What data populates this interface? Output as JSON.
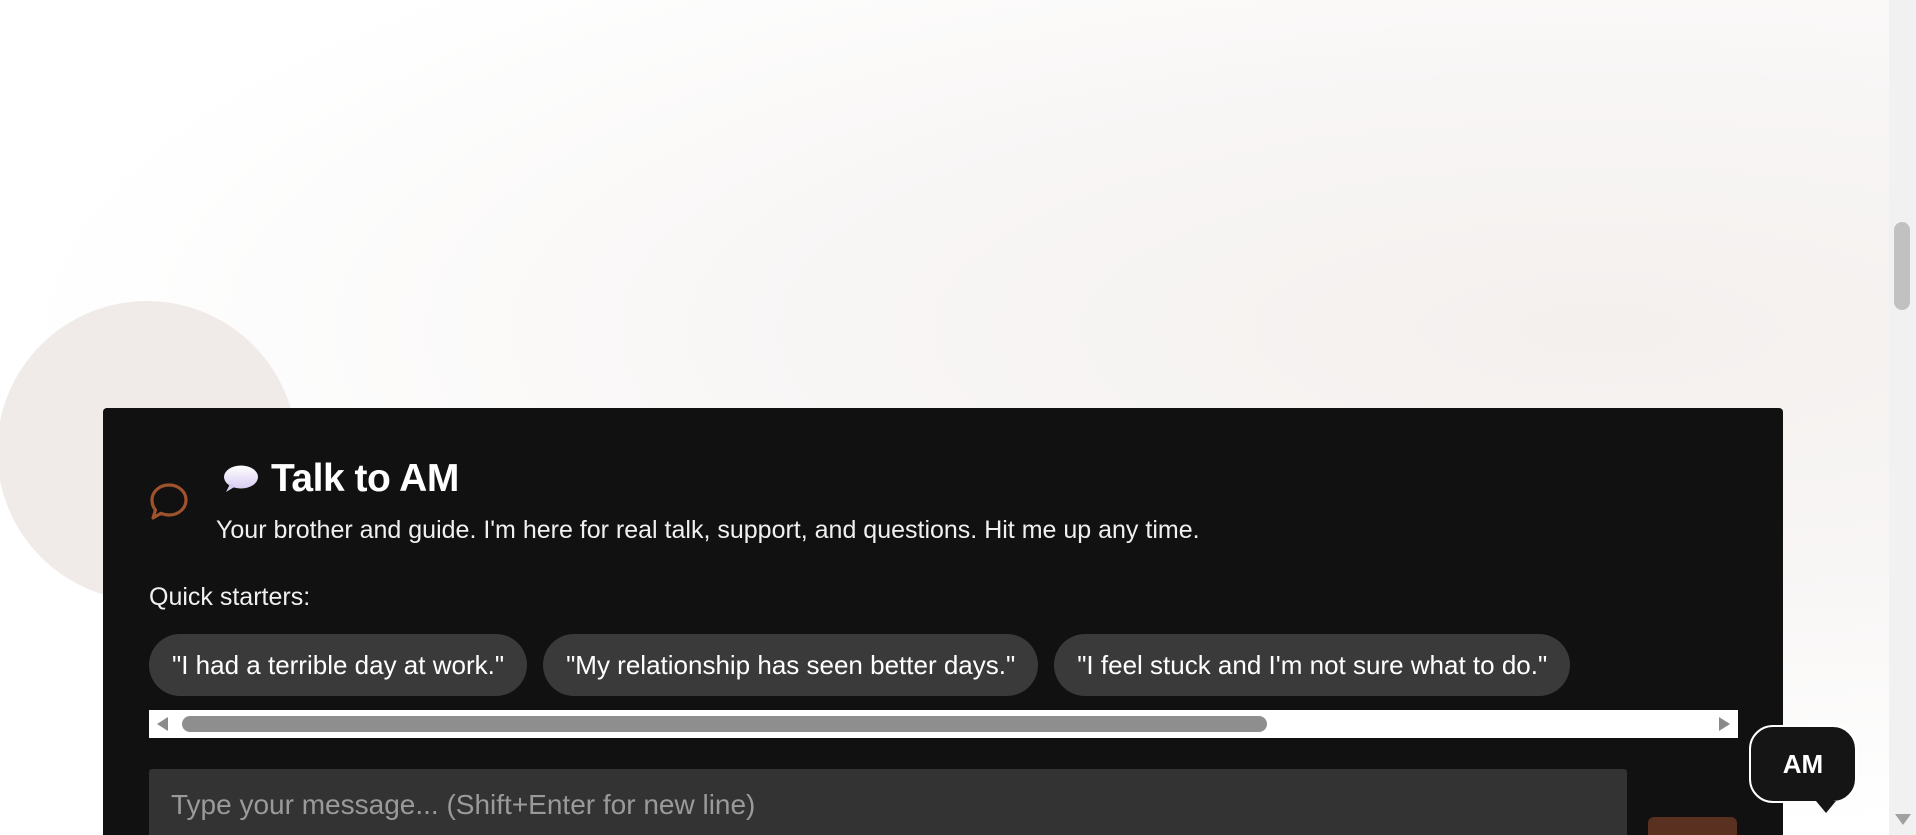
{
  "chat": {
    "title": "Talk to AM",
    "title_icon": "speech-balloon-emoji",
    "side_icon": "chat-bubble-icon",
    "subtitle": "Your brother and guide. I'm here for real talk, support, and questions. Hit me up any time.",
    "starters_label": "Quick starters:",
    "starters": [
      "\"I had a terrible day at work.\"",
      "\"My relationship has seen better days.\"",
      "\"I feel stuck and I'm not sure what to do.\""
    ],
    "input_placeholder": "Type your message... (Shift+Enter for new line)",
    "input_value": ""
  },
  "badge": {
    "label": "AM"
  },
  "colors": {
    "panel_bg": "#111111",
    "chip_bg": "#3a3a3a",
    "accent_brown": "#a0522d",
    "send_button": "#5a3020"
  }
}
